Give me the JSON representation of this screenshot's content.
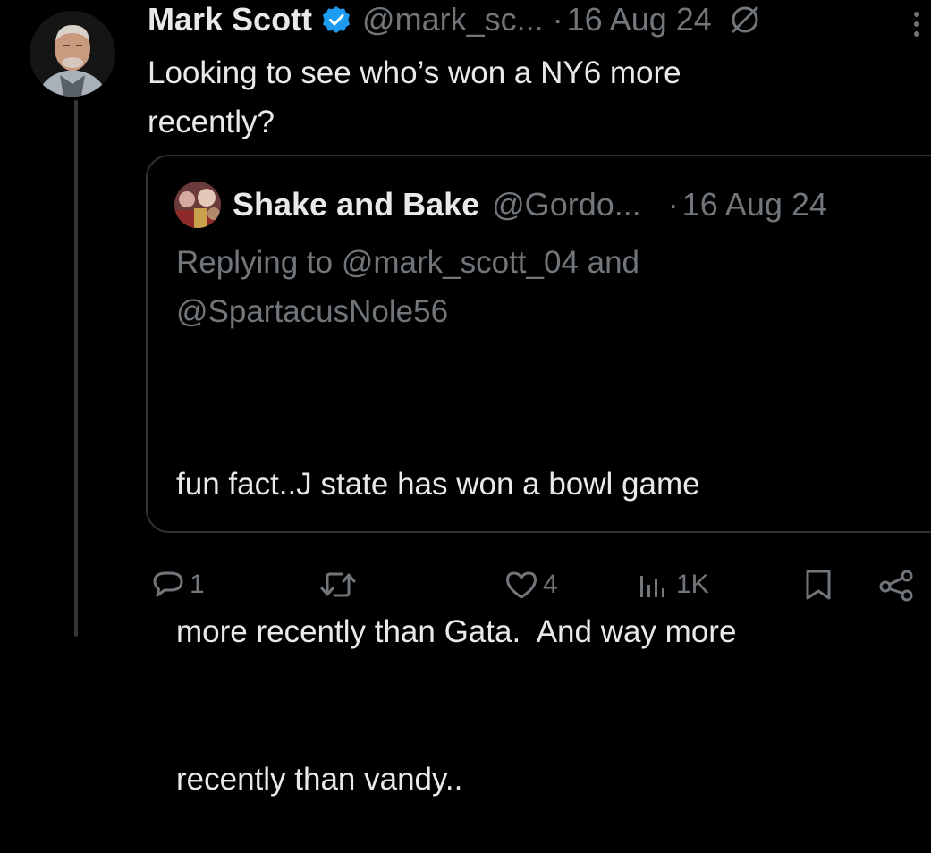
{
  "tweet": {
    "author_name": "Mark Scott",
    "handle": "@mark_sc...",
    "separator": "·",
    "timestamp": "16 Aug 24",
    "text_line1": "Looking to see who’s won a NY6 more",
    "text_line2": "recently?"
  },
  "quoted": {
    "author_name": "Shake and Bake",
    "handle": "@Gordo...",
    "separator": "·",
    "timestamp": "16 Aug 24",
    "replying_line1": "Replying to @mark_scott_04 and",
    "replying_line2": "@SpartacusNole56",
    "text_line1": "fun fact..J state has won a bowl game",
    "text_line2": "more recently than Gata.  And way more",
    "text_line3": "recently than vandy.."
  },
  "actions": {
    "reply_count": "1",
    "repost_count": "",
    "like_count": "4",
    "views_count": "1K"
  },
  "icons": {
    "verified": "verified-badge-icon",
    "grok": "grok-icon",
    "more": "more-options-icon",
    "reply": "reply-icon",
    "repost": "repost-icon",
    "like": "like-icon",
    "views": "views-icon",
    "bookmark": "bookmark-icon",
    "share": "share-icon"
  },
  "colors": {
    "background": "#000000",
    "text": "#e7e9ea",
    "secondary_text": "#71767b",
    "verified_blue": "#1d9bf0",
    "border": "#2f3336"
  }
}
